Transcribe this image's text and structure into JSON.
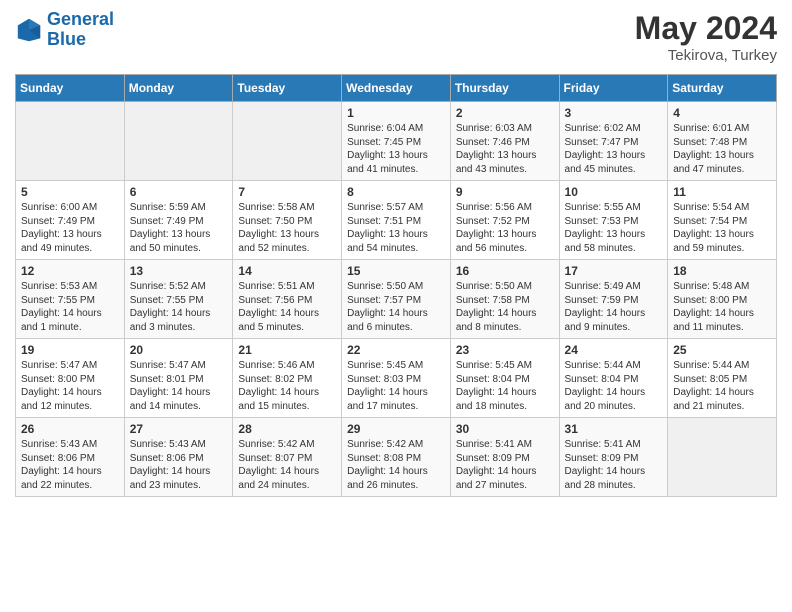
{
  "header": {
    "logo_line1": "General",
    "logo_line2": "Blue",
    "month_year": "May 2024",
    "location": "Tekirova, Turkey"
  },
  "weekdays": [
    "Sunday",
    "Monday",
    "Tuesday",
    "Wednesday",
    "Thursday",
    "Friday",
    "Saturday"
  ],
  "weeks": [
    [
      {
        "num": "",
        "info": ""
      },
      {
        "num": "",
        "info": ""
      },
      {
        "num": "",
        "info": ""
      },
      {
        "num": "1",
        "info": "Sunrise: 6:04 AM\nSunset: 7:45 PM\nDaylight: 13 hours\nand 41 minutes."
      },
      {
        "num": "2",
        "info": "Sunrise: 6:03 AM\nSunset: 7:46 PM\nDaylight: 13 hours\nand 43 minutes."
      },
      {
        "num": "3",
        "info": "Sunrise: 6:02 AM\nSunset: 7:47 PM\nDaylight: 13 hours\nand 45 minutes."
      },
      {
        "num": "4",
        "info": "Sunrise: 6:01 AM\nSunset: 7:48 PM\nDaylight: 13 hours\nand 47 minutes."
      }
    ],
    [
      {
        "num": "5",
        "info": "Sunrise: 6:00 AM\nSunset: 7:49 PM\nDaylight: 13 hours\nand 49 minutes."
      },
      {
        "num": "6",
        "info": "Sunrise: 5:59 AM\nSunset: 7:49 PM\nDaylight: 13 hours\nand 50 minutes."
      },
      {
        "num": "7",
        "info": "Sunrise: 5:58 AM\nSunset: 7:50 PM\nDaylight: 13 hours\nand 52 minutes."
      },
      {
        "num": "8",
        "info": "Sunrise: 5:57 AM\nSunset: 7:51 PM\nDaylight: 13 hours\nand 54 minutes."
      },
      {
        "num": "9",
        "info": "Sunrise: 5:56 AM\nSunset: 7:52 PM\nDaylight: 13 hours\nand 56 minutes."
      },
      {
        "num": "10",
        "info": "Sunrise: 5:55 AM\nSunset: 7:53 PM\nDaylight: 13 hours\nand 58 minutes."
      },
      {
        "num": "11",
        "info": "Sunrise: 5:54 AM\nSunset: 7:54 PM\nDaylight: 13 hours\nand 59 minutes."
      }
    ],
    [
      {
        "num": "12",
        "info": "Sunrise: 5:53 AM\nSunset: 7:55 PM\nDaylight: 14 hours\nand 1 minute."
      },
      {
        "num": "13",
        "info": "Sunrise: 5:52 AM\nSunset: 7:55 PM\nDaylight: 14 hours\nand 3 minutes."
      },
      {
        "num": "14",
        "info": "Sunrise: 5:51 AM\nSunset: 7:56 PM\nDaylight: 14 hours\nand 5 minutes."
      },
      {
        "num": "15",
        "info": "Sunrise: 5:50 AM\nSunset: 7:57 PM\nDaylight: 14 hours\nand 6 minutes."
      },
      {
        "num": "16",
        "info": "Sunrise: 5:50 AM\nSunset: 7:58 PM\nDaylight: 14 hours\nand 8 minutes."
      },
      {
        "num": "17",
        "info": "Sunrise: 5:49 AM\nSunset: 7:59 PM\nDaylight: 14 hours\nand 9 minutes."
      },
      {
        "num": "18",
        "info": "Sunrise: 5:48 AM\nSunset: 8:00 PM\nDaylight: 14 hours\nand 11 minutes."
      }
    ],
    [
      {
        "num": "19",
        "info": "Sunrise: 5:47 AM\nSunset: 8:00 PM\nDaylight: 14 hours\nand 12 minutes."
      },
      {
        "num": "20",
        "info": "Sunrise: 5:47 AM\nSunset: 8:01 PM\nDaylight: 14 hours\nand 14 minutes."
      },
      {
        "num": "21",
        "info": "Sunrise: 5:46 AM\nSunset: 8:02 PM\nDaylight: 14 hours\nand 15 minutes."
      },
      {
        "num": "22",
        "info": "Sunrise: 5:45 AM\nSunset: 8:03 PM\nDaylight: 14 hours\nand 17 minutes."
      },
      {
        "num": "23",
        "info": "Sunrise: 5:45 AM\nSunset: 8:04 PM\nDaylight: 14 hours\nand 18 minutes."
      },
      {
        "num": "24",
        "info": "Sunrise: 5:44 AM\nSunset: 8:04 PM\nDaylight: 14 hours\nand 20 minutes."
      },
      {
        "num": "25",
        "info": "Sunrise: 5:44 AM\nSunset: 8:05 PM\nDaylight: 14 hours\nand 21 minutes."
      }
    ],
    [
      {
        "num": "26",
        "info": "Sunrise: 5:43 AM\nSunset: 8:06 PM\nDaylight: 14 hours\nand 22 minutes."
      },
      {
        "num": "27",
        "info": "Sunrise: 5:43 AM\nSunset: 8:06 PM\nDaylight: 14 hours\nand 23 minutes."
      },
      {
        "num": "28",
        "info": "Sunrise: 5:42 AM\nSunset: 8:07 PM\nDaylight: 14 hours\nand 24 minutes."
      },
      {
        "num": "29",
        "info": "Sunrise: 5:42 AM\nSunset: 8:08 PM\nDaylight: 14 hours\nand 26 minutes."
      },
      {
        "num": "30",
        "info": "Sunrise: 5:41 AM\nSunset: 8:09 PM\nDaylight: 14 hours\nand 27 minutes."
      },
      {
        "num": "31",
        "info": "Sunrise: 5:41 AM\nSunset: 8:09 PM\nDaylight: 14 hours\nand 28 minutes."
      },
      {
        "num": "",
        "info": ""
      }
    ]
  ]
}
